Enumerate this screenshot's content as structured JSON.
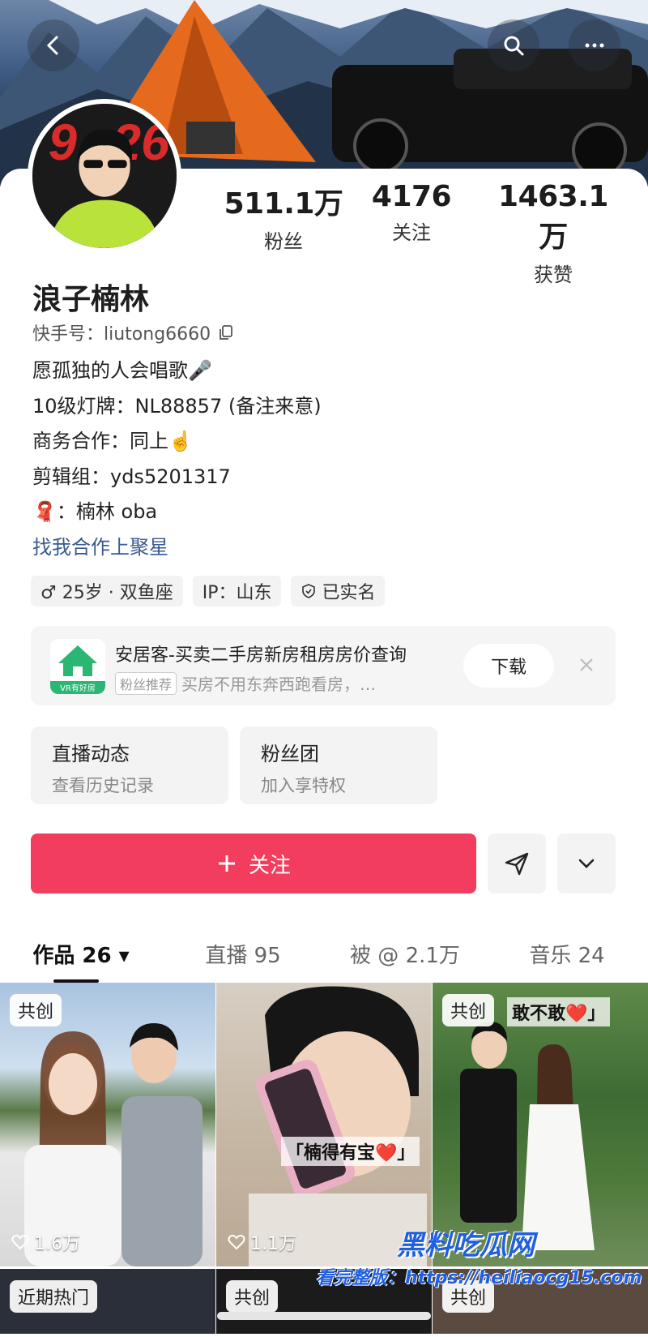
{
  "profile": {
    "name": "浪子楠林",
    "uid_label": "快手号：liutong6660",
    "stats": [
      {
        "num": "511.1万",
        "label": "粉丝"
      },
      {
        "num": "4176",
        "label": "关注"
      },
      {
        "num": "1463.1万",
        "label": "获赞"
      }
    ],
    "bio": {
      "line1": "愿孤独的人会唱歌🎤",
      "line2": "10级灯牌：NL88857 (备注来意)",
      "line3": "商务合作：同上☝️",
      "line4": "剪辑组：yds5201317",
      "line5": "🧣：楠林 oba",
      "link": "找我合作上聚星"
    },
    "tags": [
      {
        "text": "♂ 25岁 · 双鱼座"
      },
      {
        "text": "IP：山东"
      },
      {
        "text": "已实名"
      }
    ]
  },
  "ad": {
    "title": "安居客-买卖二手房新房租房房价查询",
    "badge": "粉丝推荐",
    "desc": "买房不用东奔西跑看房，…",
    "logo_text": "VR有好房",
    "download": "下载"
  },
  "entries": [
    {
      "title": "直播动态",
      "sub": "查看历史记录"
    },
    {
      "title": "粉丝团",
      "sub": "加入享特权"
    }
  ],
  "actions": {
    "follow": "关注"
  },
  "tabs": [
    {
      "label": "作品 26 ▾"
    },
    {
      "label": "直播 95"
    },
    {
      "label": "被 @ 2.1万"
    },
    {
      "label": "音乐 24"
    }
  ],
  "grid": [
    {
      "pill": "共创",
      "likes": "1.6万",
      "caption": ""
    },
    {
      "pill": "",
      "likes": "1.1万",
      "caption": "「楠得有宝❤️」"
    },
    {
      "pill": "共创",
      "likes": "",
      "caption": "敢不敢❤️」"
    },
    {
      "pill": "近期热门"
    },
    {
      "pill": "共创"
    },
    {
      "pill": "共创"
    }
  ],
  "watermark": {
    "big": "黑料吃瓜网",
    "small": "看完整版：https://heiliaocg15.com"
  },
  "colors": {
    "follow_bg": "#f23d5e",
    "link": "#3a5a8f"
  }
}
